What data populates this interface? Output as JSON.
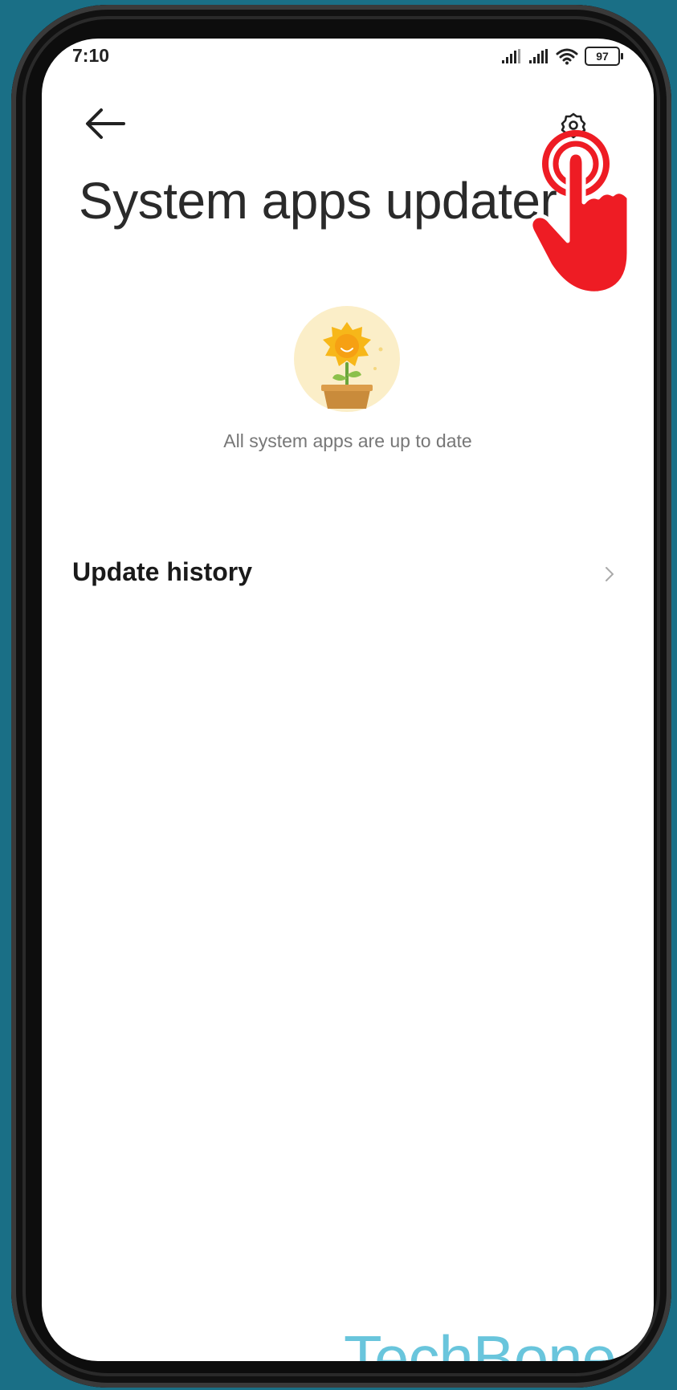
{
  "status_bar": {
    "time": "7:10",
    "battery": "97",
    "icons": [
      "signal-icon",
      "signal-icon",
      "wifi-icon",
      "battery-icon"
    ]
  },
  "header": {
    "back_icon": "arrow-left-icon",
    "settings_icon": "gear-icon",
    "title": "System apps updater"
  },
  "main": {
    "illustration": "sunflower-pot-icon",
    "status_message": "All system apps are up to date",
    "update_history_label": "Update history",
    "update_history_icon": "chevron-right-icon"
  },
  "overlay": {
    "tap_indicator": "tap-hand-icon",
    "tap_color": "#ee1c24"
  },
  "watermark": {
    "text": "TechBone",
    "color": "#69c5dc"
  }
}
